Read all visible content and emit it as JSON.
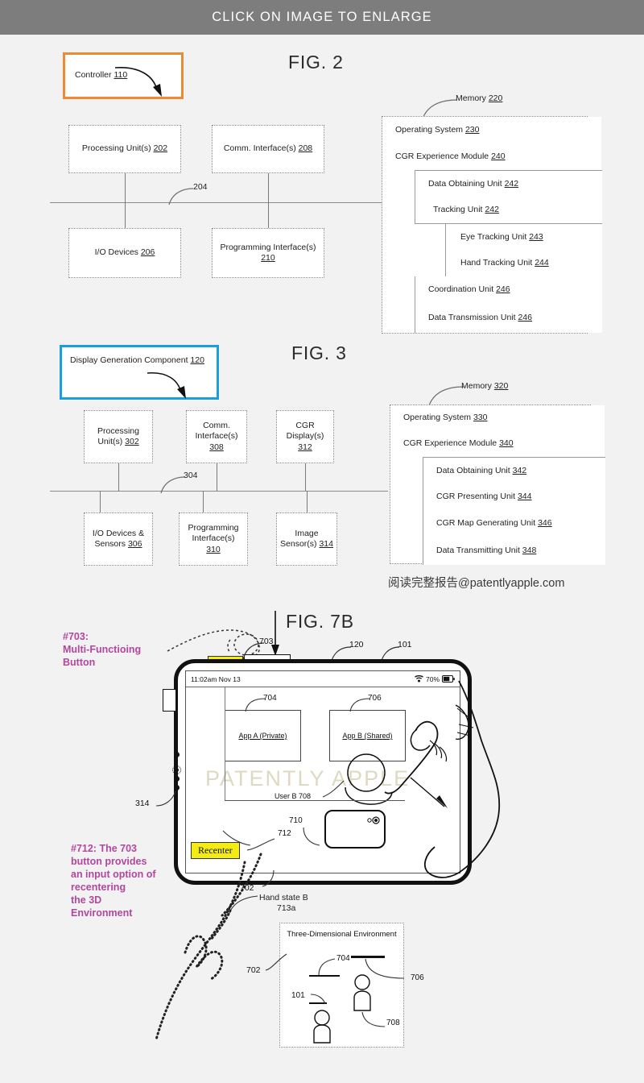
{
  "header": {
    "banner_text": "CLICK ON IMAGE TO ENLARGE"
  },
  "colors": {
    "banner_bg": "#7d7d7d",
    "page_bg": "#f2f2f2",
    "highlight_orange": "#ed8b33",
    "highlight_blue": "#19a0dc",
    "annotation_magenta": "#b3469e",
    "button_yellow": "#f5ec13",
    "watermark_tan": "#d9d4b8"
  },
  "fig2": {
    "title": "FIG. 2",
    "controller_box": {
      "label": "Controller",
      "ref": "110"
    },
    "blocks": [
      {
        "label": "Processing Unit(s)",
        "ref": "202"
      },
      {
        "label": "Comm. Interface(s)",
        "ref": "208"
      },
      {
        "label": "I/O Devices",
        "ref": "206"
      },
      {
        "label": "Programming Interface(s)",
        "ref": "210"
      }
    ],
    "bus_ref": "204",
    "memory": {
      "label": "Memory",
      "ref": "220",
      "rows": [
        {
          "label": "Operating System",
          "ref": "230",
          "indent": 0
        },
        {
          "label": "CGR Experience Module",
          "ref": "240",
          "indent": 0
        },
        {
          "label": "Data Obtaining Unit",
          "ref": "242",
          "indent": 1
        },
        {
          "label": "Tracking Unit",
          "ref": "242",
          "indent": 1
        },
        {
          "label": "Eye Tracking Unit",
          "ref": "243",
          "indent": 2
        },
        {
          "label": "Hand Tracking Unit",
          "ref": "244",
          "indent": 2
        },
        {
          "label": "Coordination Unit",
          "ref": "246",
          "indent": 1
        },
        {
          "label": "Data Transmission Unit",
          "ref": "246",
          "indent": 1
        }
      ]
    }
  },
  "fig3": {
    "title": "FIG. 3",
    "component_box": {
      "label": "Display Generation Component",
      "ref": "120"
    },
    "blocks": [
      {
        "line1": "Processing",
        "line2": "Unit(s)",
        "ref": "302"
      },
      {
        "line1": "Comm.",
        "line2": "Interface(s)",
        "ref": "308"
      },
      {
        "line1": "CGR",
        "line2": "Display(s)",
        "ref": "312"
      },
      {
        "line1": "I/O Devices &",
        "line2": "Sensors",
        "ref": "306"
      },
      {
        "line1": "Programming",
        "line2": "Interface(s)",
        "ref": "310"
      },
      {
        "line1": "Image",
        "line2": "Sensor(s)",
        "ref": "314"
      }
    ],
    "bus_ref": "304",
    "memory": {
      "label": "Memory",
      "ref": "320",
      "rows": [
        {
          "label": "Operating System",
          "ref": "330",
          "indent": 0
        },
        {
          "label": "CGR Experience Module",
          "ref": "340",
          "indent": 0
        },
        {
          "label": "Data Obtaining Unit",
          "ref": "342",
          "indent": 1
        },
        {
          "label": "CGR Presenting Unit",
          "ref": "344",
          "indent": 1
        },
        {
          "label": "CGR Map Generating Unit",
          "ref": "346",
          "indent": 1
        },
        {
          "label": "Data Transmitting Unit",
          "ref": "348",
          "indent": 1
        }
      ]
    }
  },
  "watermarks": {
    "chinese_line": "阅读完整报告@patentlyapple.com",
    "overlay": "PATENTLY APPLE"
  },
  "fig7b": {
    "title": "FIG. 7B",
    "annotation_703": "#703:\nMulti-Functioing\nButton",
    "annotation_712": "#712: The 703\nbutton provides\nan input option of\nrecentering\nthe 3D\nEnvironment",
    "status_bar": {
      "time": "11:02am Nov 13",
      "battery_pct": "70%"
    },
    "app_a": "App A (Private)",
    "app_b": "App B (Shared)",
    "recenter_button": "Recenter",
    "hand_state_label": "Hand state B",
    "hand_state_ref": "713a",
    "user_b_label": "User B 708",
    "refs": {
      "r703": "703",
      "r120": "120",
      "r101": "101",
      "r314": "314",
      "r704": "704",
      "r706": "706",
      "r710": "710",
      "r712": "712",
      "r702": "702"
    },
    "env_panel": {
      "title": "Three-Dimensional Environment",
      "refs": {
        "r702": "702",
        "r704": "704",
        "r706": "706",
        "r708": "708",
        "r101": "101"
      }
    }
  }
}
